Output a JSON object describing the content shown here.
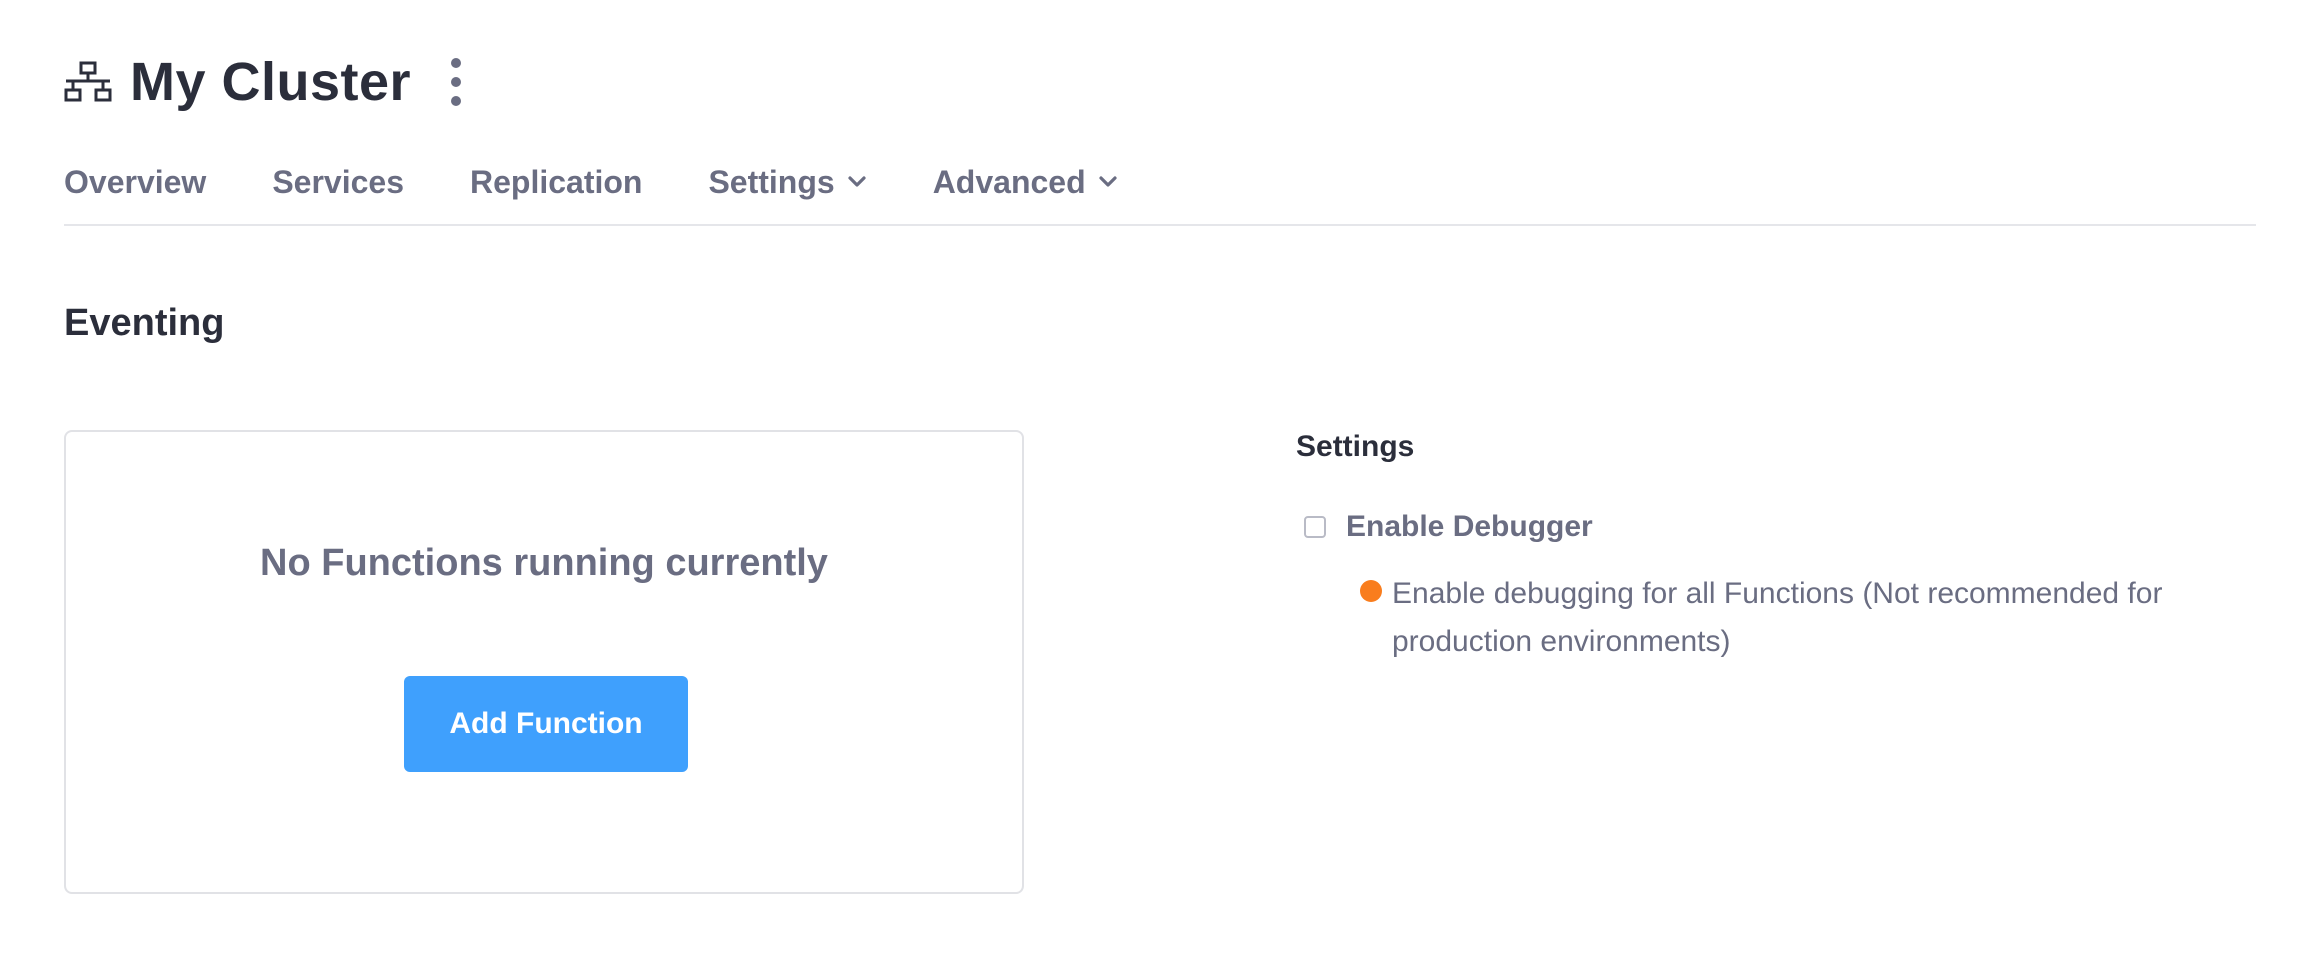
{
  "header": {
    "icon": "cluster-network-icon",
    "title": "My Cluster",
    "menu_icon": "more-vertical-icon"
  },
  "nav": {
    "tabs": [
      {
        "label": "Overview",
        "dropdown": false
      },
      {
        "label": "Services",
        "dropdown": false
      },
      {
        "label": "Replication",
        "dropdown": false
      },
      {
        "label": "Settings",
        "dropdown": true
      },
      {
        "label": "Advanced",
        "dropdown": true
      }
    ]
  },
  "page": {
    "section_title": "Eventing"
  },
  "functions_panel": {
    "empty_message": "No Functions running currently",
    "add_button_label": "Add Function"
  },
  "settings": {
    "title": "Settings",
    "enable_debugger_label": "Enable Debugger",
    "enable_debugger_checked": false,
    "debugger_note": "Enable debugging for all Functions (Not recommended for production environments)"
  },
  "colors": {
    "accent": "#3fa0fd",
    "warning": "#f97d1d",
    "text_primary": "#2b2e3b",
    "text_secondary": "#6a6d82"
  }
}
